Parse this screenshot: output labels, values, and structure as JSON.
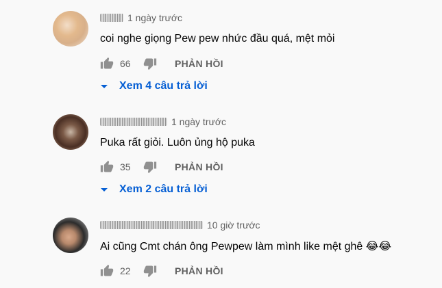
{
  "comments": [
    {
      "time": "1 ngày trước",
      "text": "coi nghe giọng Pew pew nhức đầu quá, mệt mỏi",
      "likes": "66",
      "reply_label": "PHẢN HỒI",
      "view_replies": "Xem 4 câu trả lời"
    },
    {
      "time": "1 ngày trước",
      "text": "Puka rất giỏi. Luôn ủng hộ puka",
      "likes": "35",
      "reply_label": "PHẢN HỒI",
      "view_replies": "Xem 2 câu trả lời"
    },
    {
      "time": "10 giờ trước",
      "text": "Ai cũng Cmt chán ông  Pewpew làm mình like mệt ghê ",
      "emoji": "😂😂",
      "likes": "22",
      "reply_label": "PHẢN HỒI"
    }
  ],
  "icons": {
    "like": "thumbs-up-icon",
    "dislike": "thumbs-down-icon",
    "expand": "caret-down-icon"
  },
  "colors": {
    "link": "#065fd4",
    "secondary_text": "#606060",
    "icon": "#909090"
  }
}
